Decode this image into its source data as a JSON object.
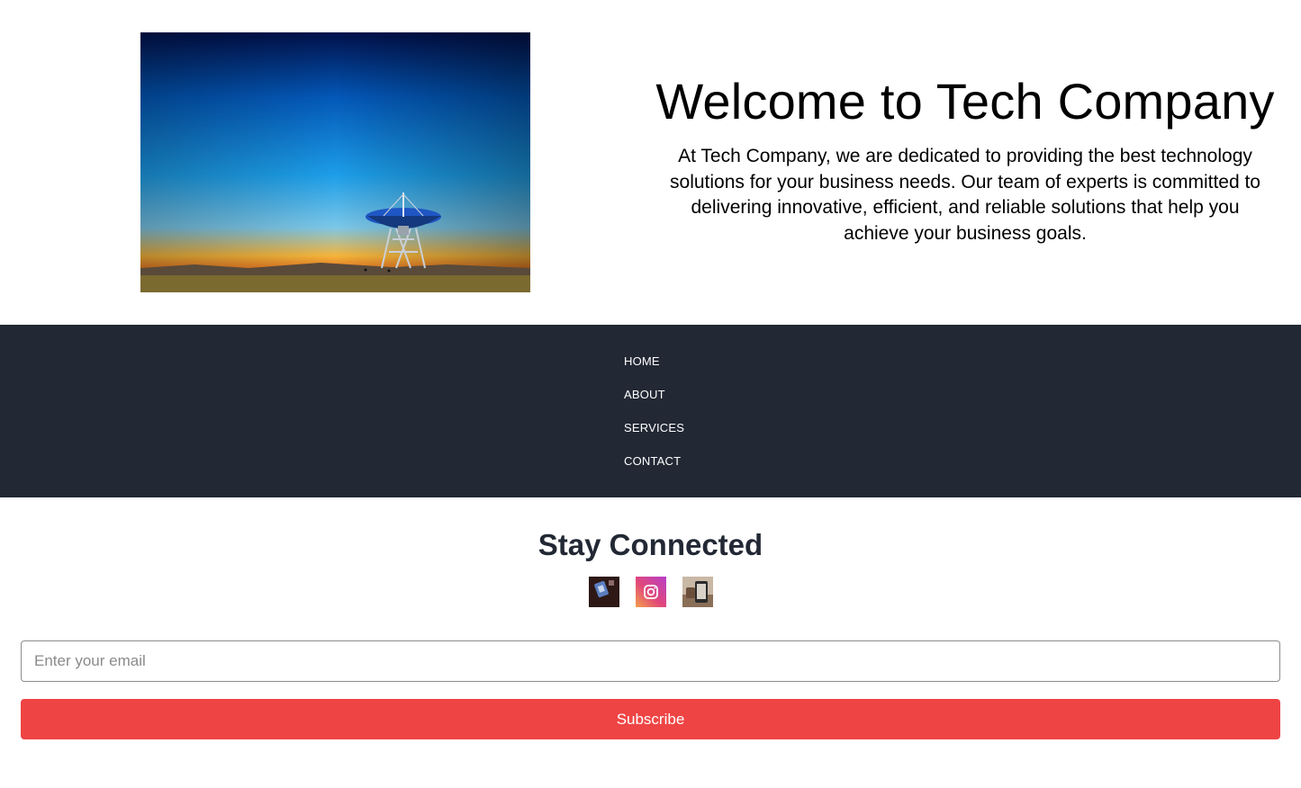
{
  "hero": {
    "title": "Welcome to Tech Company",
    "description": "At Tech Company, we are dedicated to providing the best technology solutions for your business needs. Our team of experts is committed to delivering innovative, efficient, and reliable solutions that help you achieve your business goals.",
    "image_icon": "radio-telescope-sunset-photo"
  },
  "nav": {
    "background": "#222834",
    "items": [
      {
        "label": "HOME"
      },
      {
        "label": "ABOUT"
      },
      {
        "label": "SERVICES"
      },
      {
        "label": "CONTACT"
      }
    ]
  },
  "connect": {
    "title": "Stay Connected",
    "socials": [
      {
        "icon": "social-photo-1-icon"
      },
      {
        "icon": "instagram-icon"
      },
      {
        "icon": "social-photo-3-icon"
      }
    ],
    "email_placeholder": "Enter your email",
    "subscribe_label": "Subscribe",
    "accent": "#ef4444"
  }
}
